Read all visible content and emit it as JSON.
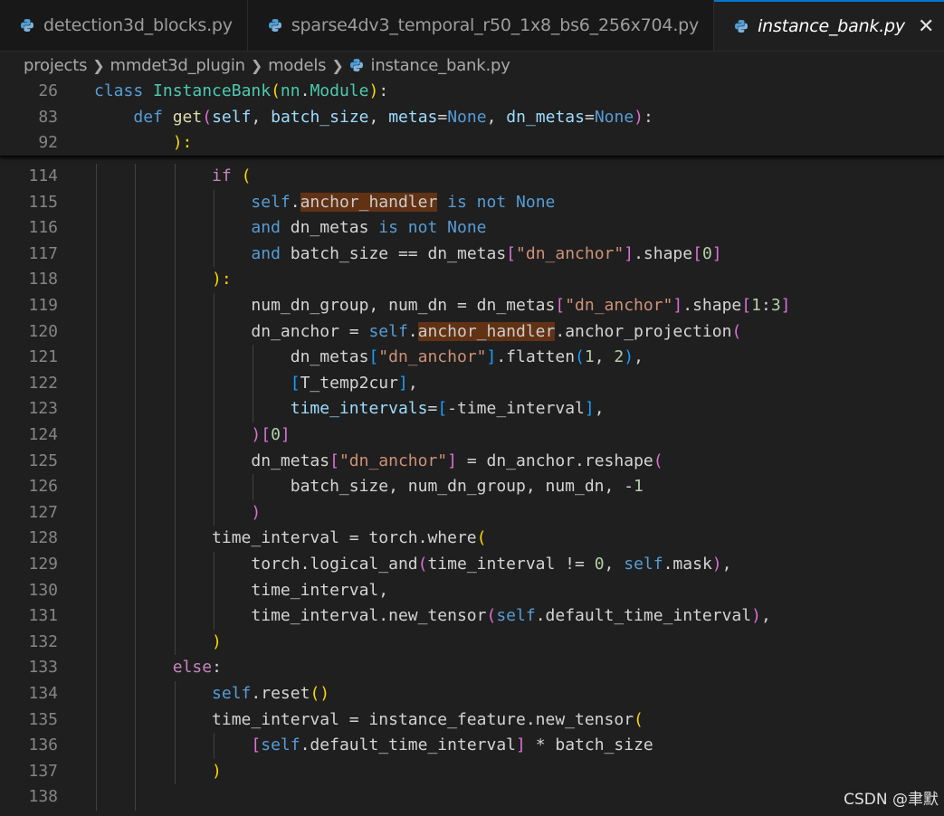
{
  "tabs": [
    {
      "label": "detection3d_blocks.py",
      "active": false
    },
    {
      "label": "sparse4dv3_temporal_r50_1x8_bs6_256x704.py",
      "active": false
    },
    {
      "label": "instance_bank.py",
      "active": true
    }
  ],
  "breadcrumb": [
    "projects",
    "mmdet3d_plugin",
    "models",
    "instance_bank.py"
  ],
  "sticky_lines": [
    {
      "n": "26",
      "tokens": [
        [
          "k",
          "class "
        ],
        [
          "c",
          "InstanceBank"
        ],
        [
          "b1",
          "("
        ],
        [
          "c",
          "nn"
        ],
        [
          "t",
          "."
        ],
        [
          "c",
          "Module"
        ],
        [
          "b1",
          ")"
        ],
        [
          "t",
          ":"
        ]
      ]
    },
    {
      "n": "83",
      "tokens": [
        [
          "t",
          "    "
        ],
        [
          "k",
          "def "
        ],
        [
          "f",
          "get"
        ],
        [
          "b2",
          "("
        ],
        [
          "v",
          "self"
        ],
        [
          "t",
          ", "
        ],
        [
          "v",
          "batch_size"
        ],
        [
          "t",
          ", "
        ],
        [
          "v",
          "metas"
        ],
        [
          "t",
          "="
        ],
        [
          "k",
          "None"
        ],
        [
          "t",
          ", "
        ],
        [
          "v",
          "dn_metas"
        ],
        [
          "t",
          "="
        ],
        [
          "k",
          "None"
        ],
        [
          "b2",
          ")"
        ],
        [
          "t",
          ":"
        ]
      ]
    },
    {
      "n": "92",
      "tokens": [
        [
          "t",
          "        "
        ],
        [
          "b1",
          "):"
        ]
      ]
    }
  ],
  "code_lines": [
    {
      "n": "114",
      "tokens": [
        [
          "t",
          "            "
        ],
        [
          "k2",
          "if "
        ],
        [
          "b1",
          "("
        ]
      ]
    },
    {
      "n": "115",
      "tokens": [
        [
          "t",
          "                "
        ],
        [
          "k",
          "self"
        ],
        [
          "t",
          "."
        ],
        [
          "hl",
          "anchor_handler"
        ],
        [
          "t",
          " "
        ],
        [
          "k",
          "is not None"
        ]
      ]
    },
    {
      "n": "116",
      "tokens": [
        [
          "t",
          "                "
        ],
        [
          "k",
          "and "
        ],
        [
          "t",
          "dn_metas "
        ],
        [
          "k",
          "is not None"
        ]
      ]
    },
    {
      "n": "117",
      "tokens": [
        [
          "t",
          "                "
        ],
        [
          "k",
          "and "
        ],
        [
          "t",
          "batch_size == dn_metas"
        ],
        [
          "b2",
          "["
        ],
        [
          "s",
          "\"dn_anchor\""
        ],
        [
          "b2",
          "]"
        ],
        [
          "t",
          ".shape"
        ],
        [
          "b2",
          "["
        ],
        [
          "n",
          "0"
        ],
        [
          "b2",
          "]"
        ]
      ]
    },
    {
      "n": "118",
      "tokens": [
        [
          "t",
          "            "
        ],
        [
          "b1",
          "):"
        ]
      ]
    },
    {
      "n": "119",
      "tokens": [
        [
          "t",
          "                num_dn_group, num_dn = dn_metas"
        ],
        [
          "b2",
          "["
        ],
        [
          "s",
          "\"dn_anchor\""
        ],
        [
          "b2",
          "]"
        ],
        [
          "t",
          ".shape"
        ],
        [
          "b2",
          "["
        ],
        [
          "n",
          "1"
        ],
        [
          "t",
          ":"
        ],
        [
          "n",
          "3"
        ],
        [
          "b2",
          "]"
        ]
      ]
    },
    {
      "n": "120",
      "tokens": [
        [
          "t",
          "                dn_anchor = "
        ],
        [
          "k",
          "self"
        ],
        [
          "t",
          "."
        ],
        [
          "hl",
          "anchor_handler"
        ],
        [
          "t",
          ".anchor_projection"
        ],
        [
          "b2",
          "("
        ]
      ]
    },
    {
      "n": "121",
      "tokens": [
        [
          "t",
          "                    dn_metas"
        ],
        [
          "b3",
          "["
        ],
        [
          "s",
          "\"dn_anchor\""
        ],
        [
          "b3",
          "]"
        ],
        [
          "t",
          ".flatten"
        ],
        [
          "b3",
          "("
        ],
        [
          "n",
          "1"
        ],
        [
          "t",
          ", "
        ],
        [
          "n",
          "2"
        ],
        [
          "b3",
          ")"
        ],
        [
          "t",
          ","
        ]
      ]
    },
    {
      "n": "122",
      "tokens": [
        [
          "t",
          "                    "
        ],
        [
          "b3",
          "["
        ],
        [
          "t",
          "T_temp2cur"
        ],
        [
          "b3",
          "]"
        ],
        [
          "t",
          ","
        ]
      ]
    },
    {
      "n": "123",
      "tokens": [
        [
          "t",
          "                    "
        ],
        [
          "v",
          "time_intervals"
        ],
        [
          "t",
          "="
        ],
        [
          "b3",
          "["
        ],
        [
          "t",
          "-time_interval"
        ],
        [
          "b3",
          "]"
        ],
        [
          "t",
          ","
        ]
      ]
    },
    {
      "n": "124",
      "tokens": [
        [
          "t",
          "                "
        ],
        [
          "b2",
          ")"
        ],
        [
          "b2",
          "["
        ],
        [
          "n",
          "0"
        ],
        [
          "b2",
          "]"
        ]
      ]
    },
    {
      "n": "125",
      "tokens": [
        [
          "t",
          "                dn_metas"
        ],
        [
          "b2",
          "["
        ],
        [
          "s",
          "\"dn_anchor\""
        ],
        [
          "b2",
          "]"
        ],
        [
          "t",
          " = dn_anchor.reshape"
        ],
        [
          "b2",
          "("
        ]
      ]
    },
    {
      "n": "126",
      "tokens": [
        [
          "t",
          "                    batch_size, num_dn_group, num_dn, -"
        ],
        [
          "n",
          "1"
        ]
      ]
    },
    {
      "n": "127",
      "tokens": [
        [
          "t",
          "                "
        ],
        [
          "b2",
          ")"
        ]
      ]
    },
    {
      "n": "128",
      "tokens": [
        [
          "t",
          "            time_interval = torch.where"
        ],
        [
          "b1",
          "("
        ]
      ]
    },
    {
      "n": "129",
      "tokens": [
        [
          "t",
          "                torch.logical_and"
        ],
        [
          "b2",
          "("
        ],
        [
          "t",
          "time_interval != "
        ],
        [
          "n",
          "0"
        ],
        [
          "t",
          ", "
        ],
        [
          "k",
          "self"
        ],
        [
          "t",
          ".mask"
        ],
        [
          "b2",
          ")"
        ],
        [
          "t",
          ","
        ]
      ]
    },
    {
      "n": "130",
      "tokens": [
        [
          "t",
          "                time_interval,"
        ]
      ]
    },
    {
      "n": "131",
      "tokens": [
        [
          "t",
          "                time_interval.new_tensor"
        ],
        [
          "b2",
          "("
        ],
        [
          "k",
          "self"
        ],
        [
          "t",
          ".default_time_interval"
        ],
        [
          "b2",
          ")"
        ],
        [
          "t",
          ","
        ]
      ]
    },
    {
      "n": "132",
      "tokens": [
        [
          "t",
          "            "
        ],
        [
          "b1",
          ")"
        ]
      ]
    },
    {
      "n": "133",
      "tokens": [
        [
          "t",
          "        "
        ],
        [
          "k2",
          "else"
        ],
        [
          "t",
          ":"
        ]
      ]
    },
    {
      "n": "134",
      "tokens": [
        [
          "t",
          "            "
        ],
        [
          "k",
          "self"
        ],
        [
          "t",
          ".reset"
        ],
        [
          "b1",
          "()"
        ]
      ]
    },
    {
      "n": "135",
      "tokens": [
        [
          "t",
          "            time_interval = instance_feature.new_tensor"
        ],
        [
          "b1",
          "("
        ]
      ]
    },
    {
      "n": "136",
      "tokens": [
        [
          "t",
          "                "
        ],
        [
          "b2",
          "["
        ],
        [
          "k",
          "self"
        ],
        [
          "t",
          ".default_time_interval"
        ],
        [
          "b2",
          "]"
        ],
        [
          "t",
          " * batch_size"
        ]
      ]
    },
    {
      "n": "137",
      "tokens": [
        [
          "t",
          "            "
        ],
        [
          "b1",
          ")"
        ]
      ]
    },
    {
      "n": "138",
      "tokens": []
    }
  ],
  "watermark": "CSDN @聿默",
  "colors": {
    "background": "#1f1f1f",
    "keyword": "#569cd6",
    "control": "#c586c0",
    "function": "#dcdcaa",
    "class": "#4ec9b0",
    "string": "#ce9178",
    "number": "#b5cea8",
    "highlight": "#613214"
  }
}
